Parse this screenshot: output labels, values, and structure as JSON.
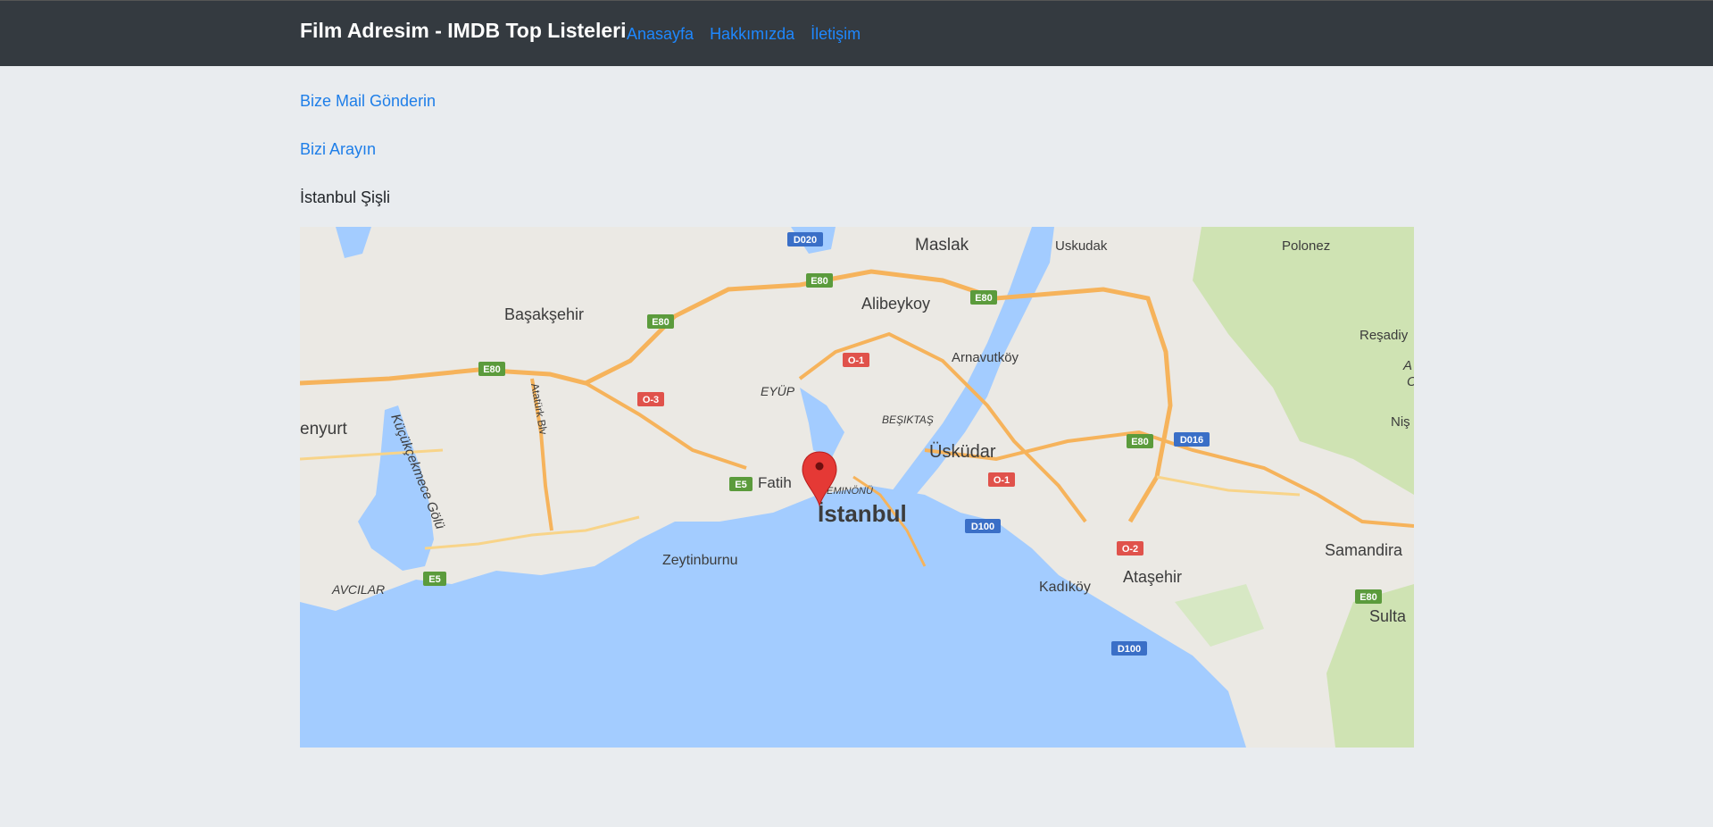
{
  "navbar": {
    "brand": "Film Adresim - IMDB Top Listeleri",
    "links": [
      "Anasayfa",
      "Hakkımızda",
      "İletişim"
    ]
  },
  "contact": {
    "mail_link": "Bize Mail Gönderin",
    "phone_link": "Bizi Arayın",
    "address": "İstanbul Şişli"
  },
  "map": {
    "labels": {
      "maslak": "Maslak",
      "uskudak": "Uskudak",
      "polonez": "Polonez",
      "basaksehir": "Başakşehir",
      "alibeykoy": "Alibeykoy",
      "resadiye": "Reşadiy",
      "arnavutkoy": "Arnavutköy",
      "eyup": "EYÜP",
      "besiktas": "BEŞIKTAŞ",
      "esenyurt": "enyurt",
      "ataturk_blv": "Atatürk Blv",
      "kucukcekmece": "Küçükçekmece Gölü",
      "uskudar": "Üsküdar",
      "nis": "Niş",
      "fatih": "Fatih",
      "eminonu": "EMINÖNÜ",
      "istanbul": "İstanbul",
      "zeytinburnu": "Zeytinburnu",
      "samandira": "Samandira",
      "atasehir": "Ataşehir",
      "kadikoy": "Kadıköy",
      "avcilar": "AVCILAR",
      "sulta": "Sulta",
      "a": "A",
      "c": "C"
    },
    "shields": {
      "d020": "D020",
      "e80_a": "E80",
      "e80_b": "E80",
      "e80_c": "E80",
      "e80_d": "E80",
      "e80_e": "E80",
      "e80_f": "E80",
      "o1_a": "O-1",
      "o1_b": "O-1",
      "o3": "O-3",
      "o2": "O-2",
      "e5_a": "E5",
      "e5_b": "E5",
      "d016": "D016",
      "d100_a": "D100",
      "d100_b": "D100"
    }
  }
}
